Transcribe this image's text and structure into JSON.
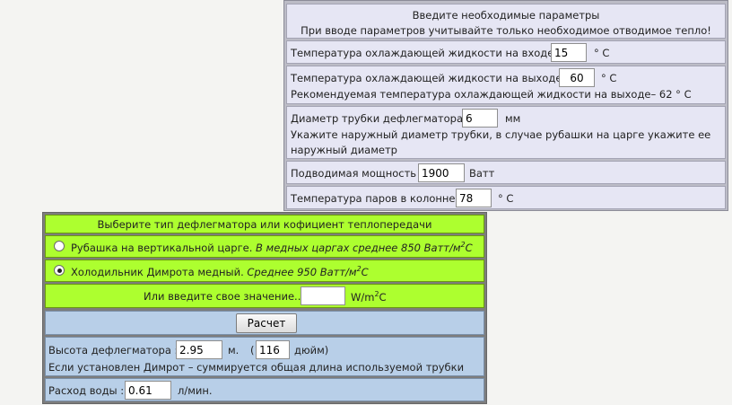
{
  "params": {
    "title": "Введите необходимые параметры",
    "subtitle": "При вводе параметров учитывайте только необходимое отводимое тепло!",
    "inlet_temp": {
      "label": "Температура охлаждающей жидкости на входе",
      "value": "15",
      "unit": "° C"
    },
    "outlet_temp": {
      "label": "Температура охлаждающей жидкости на выходе",
      "value": "60",
      "unit": "° C",
      "hint": "Рекомендуемая температура охлаждающей жидкости на выходе– 62 ° C"
    },
    "tube_diameter": {
      "label": "Диаметр трубки дефлегматора",
      "value": "6",
      "unit": "мм",
      "hint_line1": "Укажите наружный диаметр трубки, в случае рубашки на царге укажите ее",
      "hint_line2": "наружный диаметр"
    },
    "power": {
      "label": "Подводимая мощность",
      "value": "1900",
      "unit": "Ватт"
    },
    "vapor_temp": {
      "label": "Температура паров в колонне",
      "value": "78",
      "unit": "° C"
    }
  },
  "deflegmator": {
    "title": "Выберите тип дефлегматора или кофициент теплопередачи",
    "options": [
      {
        "label": "Рубашка на вертикальной царге.",
        "note_prefix": "В медных царгах среднее 850 Ватт/м",
        "sup": "2",
        "note_suffix": "C",
        "selected": false
      },
      {
        "label": "Холодильник Димрота медный.",
        "note_prefix": "Среднее 950 Ватт/м",
        "sup": "2",
        "note_suffix": "C",
        "selected": true
      }
    ],
    "custom": {
      "label": "Или введите свое значение..",
      "value": "",
      "unit_prefix": "W/m",
      "unit_sup": "2",
      "unit_suffix": "C"
    }
  },
  "results": {
    "calc_button": "Расчет",
    "height_label": "Высота дефлегматора :",
    "height_m": "2.95",
    "height_m_unit": "м.",
    "open_paren": "(",
    "height_in": "116",
    "height_in_unit": "дюйм)",
    "dimroth_note": "Если установлен Димрот – суммируется общая длина используемой трубки",
    "flow_label": "Расход воды :",
    "flow_value": "0.61",
    "flow_unit": "л/мин."
  }
}
